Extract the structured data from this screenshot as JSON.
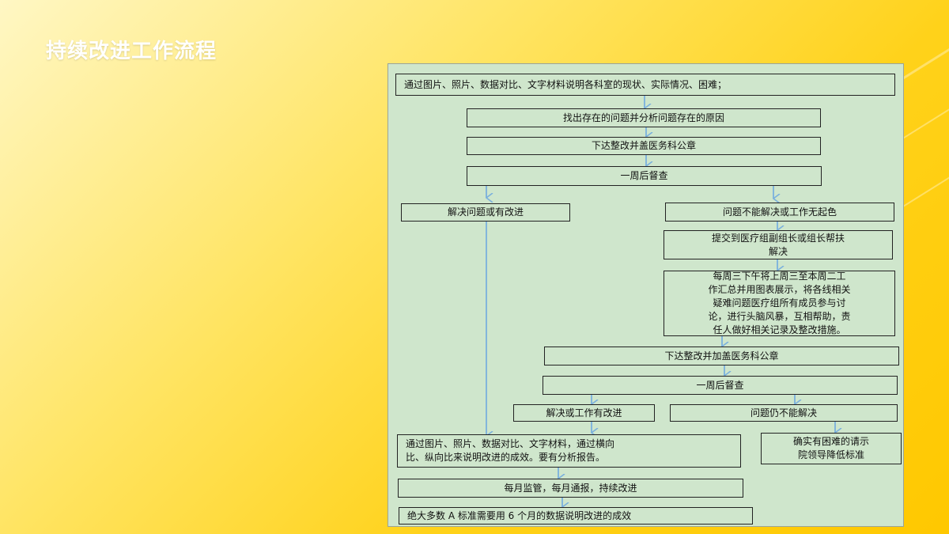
{
  "header": {
    "title": "持续改进工作流程"
  },
  "colors": {
    "arrow": "#7ab0dd",
    "box_border": "#222222",
    "panel_bg": "#cfe6cc"
  },
  "flow": {
    "step1": "通过图片、照片、数据对比、文字材料说明各科室的现状、实际情况、困难；",
    "step2": "找出存在的问题并分析问题存在的原因",
    "step3": "下达整改并盖医务科公章",
    "step4": "一周后督查",
    "branch_left": "解决问题或有改进",
    "branch_right": "问题不能解决或工作无起色",
    "submit": "提交到医疗组副组长或组长帮扶\n解决",
    "weekly_meeting": "每周三下午将上周三至本周二工\n作汇总并用图表展示，将各线相关\n疑难问题医疗组所有成员参与讨\n论，进行头脑风暴，互相帮助，责\n任人做好相关记录及整改措施。",
    "step5": "下达整改并加盖医务科公章",
    "step6": "一周后督查",
    "resolved": "解决或工作有改进",
    "unresolved": "问题仍不能解决",
    "report": "通过图片、照片、数据对比、文字材料，通过横向\n比、纵向比来说明改进的成效。要有分析报告。",
    "escalate": "确实有困难的请示\n院领导降低标准",
    "monitor": "每月监管，每月通报，持续改进",
    "final": "绝大多数 A 标准需要用 6 个月的数据说明改进的成效"
  }
}
